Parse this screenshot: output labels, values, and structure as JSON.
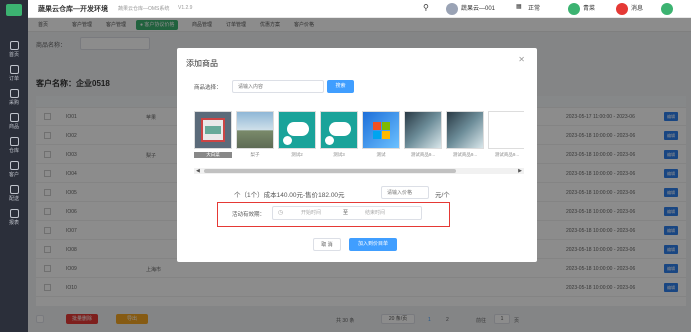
{
  "app": {
    "title": "蔬果云仓库—开发环境",
    "subtitle": "蔬果云仓库—OMS系统",
    "version": "V1.2.9",
    "user": "蔬果云—001",
    "msg_label": "消息",
    "extra_label": "正常",
    "green_label": "青菜",
    "red_label": "消息"
  },
  "sidebar": {
    "items": [
      {
        "label": "首页"
      },
      {
        "label": "订单"
      },
      {
        "label": "采购"
      },
      {
        "label": "商品"
      },
      {
        "label": "仓库"
      },
      {
        "label": "客户"
      },
      {
        "label": "配送"
      },
      {
        "label": "报表"
      }
    ]
  },
  "tabs": [
    {
      "label": "首页"
    },
    {
      "label": "客户管理"
    },
    {
      "label": "客户管理"
    },
    {
      "label": "● 客户协议价格",
      "active": true
    },
    {
      "label": "商品管理"
    },
    {
      "label": "订单管理"
    },
    {
      "label": "优惠方案"
    },
    {
      "label": "客户价格"
    }
  ],
  "page": {
    "filter_label": "商品名称：",
    "customer_title": "客户名称：企业0518"
  },
  "table": {
    "rows": [
      {
        "a": "IO01",
        "b": "苹果",
        "c": "普通",
        "d": "",
        "date": "2023-05-17 11:00:00 - 2023-06"
      },
      {
        "a": "IO02",
        "b": "",
        "c": "普通",
        "d": "",
        "date": "2023-05-18 10:00:00 - 2023-06"
      },
      {
        "a": "IO03",
        "b": "梨子",
        "c": "",
        "d": "",
        "date": "2023-05-18 10:00:00 - 2023-06"
      },
      {
        "a": "IO04",
        "b": "",
        "c": "",
        "d": "",
        "date": "2023-05-18 10:00:00 - 2023-06"
      },
      {
        "a": "IO05",
        "b": "",
        "c": "测试",
        "d": "",
        "date": "2023-05-18 10:00:00 - 2023-06"
      },
      {
        "a": "IO06",
        "b": "",
        "c": "测试",
        "d": "",
        "date": "2023-05-18 10:00:00 - 2023-06"
      },
      {
        "a": "IO07",
        "b": "",
        "c": "测试",
        "d": "",
        "date": "2023-05-18 10:00:00 - 2023-06"
      },
      {
        "a": "IO08",
        "b": "",
        "c": "测试",
        "d": "",
        "date": "2023-05-18 10:00:00 - 2023-06"
      },
      {
        "a": "IO09",
        "b": "上海市",
        "c": "",
        "d": "",
        "date": "2023-05-18 10:00:00 - 2023-06"
      },
      {
        "a": "IO10",
        "b": "",
        "c": "",
        "d": "",
        "date": "2023-05-18 10:00:00 - 2023-06"
      }
    ],
    "edit_label": "编辑"
  },
  "footer": {
    "btn1": "批量删除",
    "btn2": "导出",
    "total": "共 30 条",
    "page_size": "20 条/页",
    "pages": [
      "1",
      "2"
    ],
    "goto": "前往",
    "page_input": "1",
    "page_unit": "页"
  },
  "modal": {
    "title": "添加商品",
    "goods_label": "商品选择：",
    "goods_placeholder": "请输入内容",
    "search_btn": "搜索",
    "products": [
      {
        "caption": "大白菜",
        "kind": "folder"
      },
      {
        "caption": "梨子",
        "kind": "road"
      },
      {
        "caption": "测试2",
        "kind": "cloud"
      },
      {
        "caption": "测试3",
        "kind": "cloud"
      },
      {
        "caption": "测试",
        "kind": "win"
      },
      {
        "caption": "测试商品9...",
        "kind": "sea"
      },
      {
        "caption": "测试商品9...",
        "kind": "sea"
      },
      {
        "caption": "测试商品9...",
        "kind": "blank"
      }
    ],
    "price_prefix": "个（",
    "qty": "1",
    "price_text": "个）成本140.00元-售价182.00元",
    "price_placeholder": "请输入价格",
    "price_unit": "元/个",
    "period_label": "活动有效期：",
    "start_placeholder": "开始时间",
    "to_label": "至",
    "end_placeholder": "结束时间",
    "cancel": "取 消",
    "confirm": "加入到价目单",
    "colors": {
      "primary": "#409eff",
      "highlight": "#e53935"
    }
  }
}
